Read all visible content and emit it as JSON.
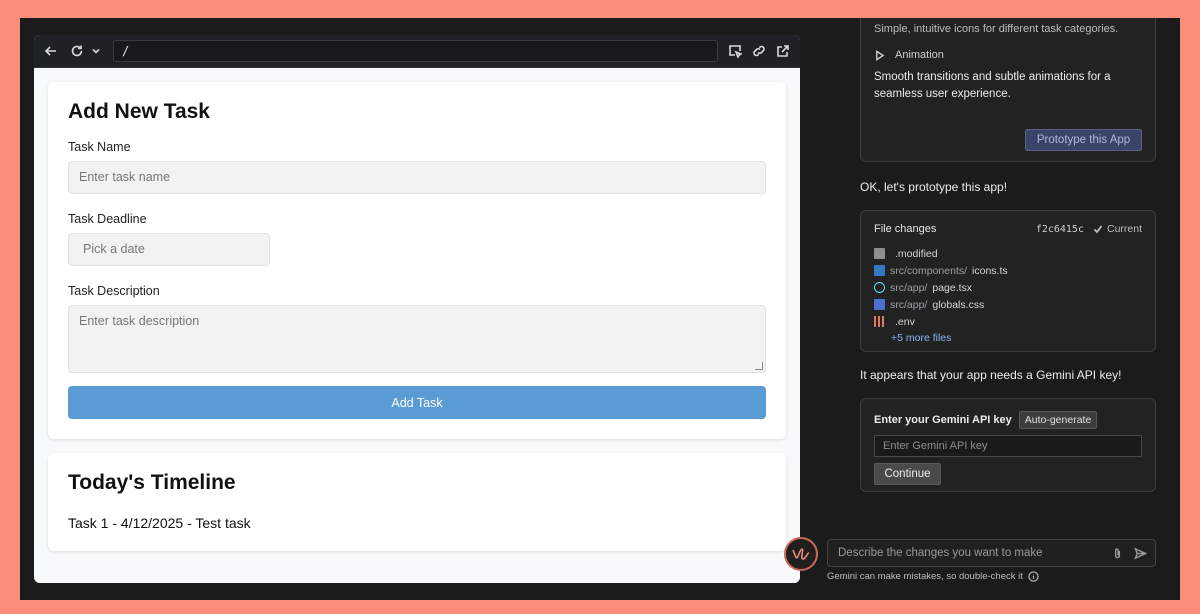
{
  "browser": {
    "url": "/"
  },
  "form": {
    "title": "Add New Task",
    "task_name_label": "Task Name",
    "task_name_placeholder": "Enter task name",
    "deadline_label": "Task Deadline",
    "deadline_placeholder": "Pick a date",
    "description_label": "Task Description",
    "description_placeholder": "Enter task description",
    "submit_label": "Add Task"
  },
  "timeline": {
    "title": "Today's Timeline",
    "tasks": [
      "Task 1 - 4/12/2025 - Test task"
    ]
  },
  "chat": {
    "feature_intro": "Simple, intuitive icons for different task categories.",
    "feature_name": "Animation",
    "feature_desc": "Smooth transitions and subtle animations for a seamless user experience.",
    "prototype_button": "Prototype this App",
    "message_1": "OK, let's prototype this app!",
    "file_changes": {
      "title": "File changes",
      "hash": "f2c6415c",
      "status": "Current",
      "files": [
        {
          "dir": "",
          "name": ".modified",
          "icon": "file-icon",
          "color": "#8e8e8e"
        },
        {
          "dir": "src/components/",
          "name": "icons.ts",
          "icon": "typescript-icon",
          "color": "#3178c6"
        },
        {
          "dir": "src/app/",
          "name": "page.tsx",
          "icon": "react-icon",
          "color": "#61dafb"
        },
        {
          "dir": "src/app/",
          "name": "globals.css",
          "icon": "css-icon",
          "color": "#4a6fd1"
        },
        {
          "dir": "",
          "name": ".env",
          "icon": "settings-icon",
          "color": "#e07a5f"
        }
      ],
      "more": "+5 more files"
    },
    "message_2": "It appears that your app needs a Gemini API key!",
    "api_key": {
      "title": "Enter your Gemini API key",
      "auto_label": "Auto-generate",
      "placeholder": "Enter Gemini API key",
      "continue_label": "Continue"
    },
    "composer_placeholder": "Describe the changes you want to make",
    "disclaimer": "Gemini can make mistakes, so double-check it"
  }
}
